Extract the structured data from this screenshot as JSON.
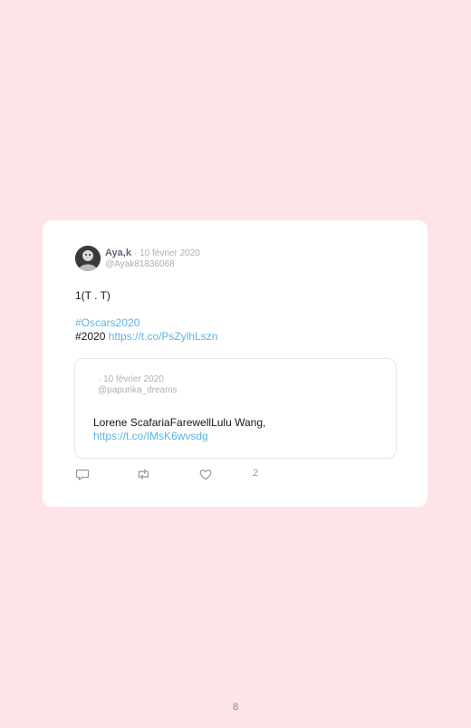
{
  "tweet": {
    "author_name": "Aya,k",
    "date": "· 10 février 2020",
    "handle": "@Ayak81836068",
    "text_line1": "1(T . T)",
    "hashtag": "#Oscars2020",
    "text_line3_prefix": "#2020",
    "link": "https://t.co/PsZylhLszn",
    "like_count": "2"
  },
  "quoted_tweet": {
    "date": "· 10 février 2020",
    "handle": "@papurika_dreams",
    "text": "Lorene ScafariaFarewellLulu Wang,",
    "link": "https://t.co/IMsK6wvsdg"
  },
  "page_number": "8",
  "icons": [
    "avatar",
    "reply-icon",
    "retweet-icon",
    "like-icon"
  ],
  "colors": {
    "background": "#fee3e7",
    "card": "#ffffff",
    "link": "#5bb4e5",
    "muted": "#a9b1b8"
  }
}
